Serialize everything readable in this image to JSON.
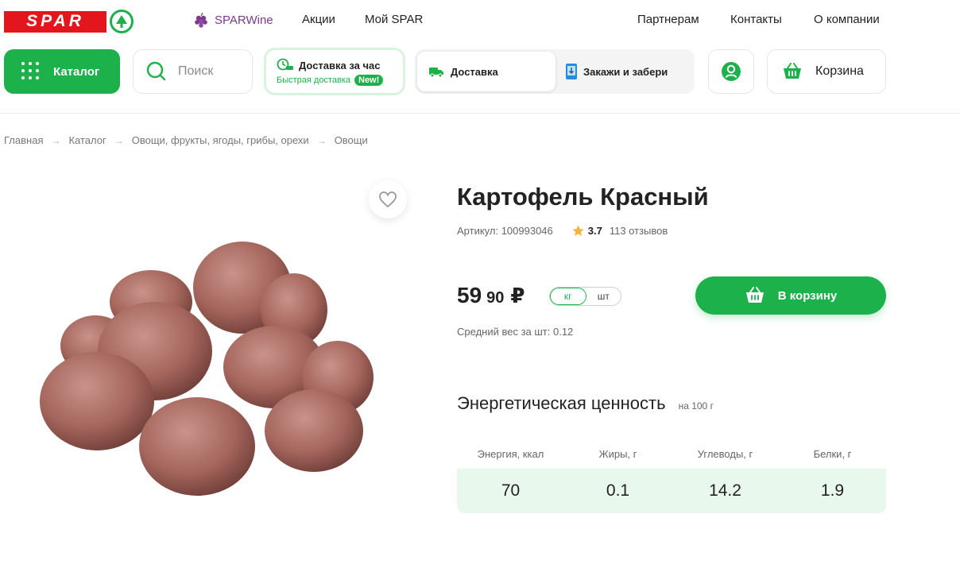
{
  "brand": {
    "name": "SPAR",
    "color": "#e3161e",
    "accent": "#1db14b"
  },
  "top_nav": {
    "wine": "SPARWine",
    "promo": "Акции",
    "my_spar": "Мой SPAR",
    "partners": "Партнерам",
    "contacts": "Контакты",
    "about": "О компании"
  },
  "header": {
    "catalog": "Каталог",
    "search_placeholder": "Поиск",
    "express_title": "Доставка за час",
    "express_subtitle": "Быстрая доставка",
    "express_badge": "New!",
    "delivery_tab": "Доставка",
    "pickup_tab": "Закажи и забери",
    "cart": "Корзина"
  },
  "breadcrumb": [
    "Главная",
    "Каталог",
    "Овощи, фрукты, ягоды, грибы, орехи",
    "Овощи"
  ],
  "product": {
    "title": "Картофель Красный",
    "article": "Артикул: 100993046",
    "rating": "3.7",
    "reviews": "113 отзывов",
    "price_rub": "59",
    "price_kop": "90",
    "currency": "₽",
    "units": [
      "кг",
      "шт"
    ],
    "selected_unit": "кг",
    "buy_button": "В корзину",
    "avg_weight": "Средний вес за шт: 0.12"
  },
  "nutrition": {
    "title": "Энергетическая ценность",
    "note": "на 100 г",
    "items": [
      {
        "label": "Энергия, ккал",
        "value": "70"
      },
      {
        "label": "Жиры, г",
        "value": "0.1"
      },
      {
        "label": "Углеводы, г",
        "value": "14.2"
      },
      {
        "label": "Белки, г",
        "value": "1.9"
      }
    ]
  }
}
